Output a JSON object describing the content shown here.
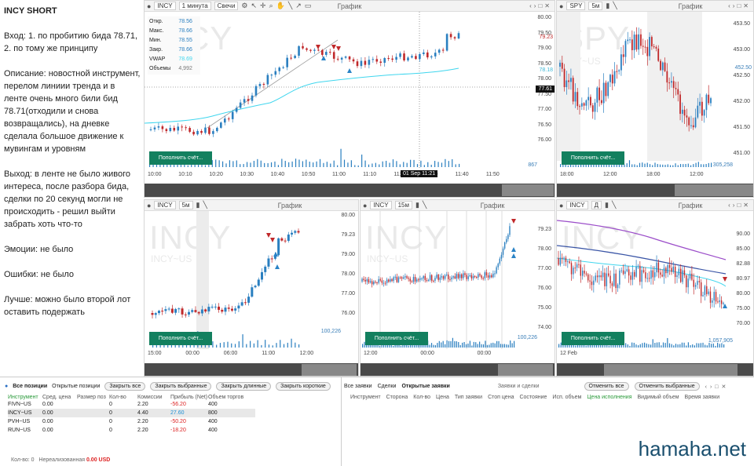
{
  "notes": {
    "title": "INCY SHORT",
    "entry": "Вход: 1. по пробитию бида 78.71, 2. по тому же принципу",
    "description": "Описание: новостной инструмент, перелом линиии тренда и в ленте очень много били бид 78.71(отходили и снова возвращались), на дневке сделала большое движение к мувингам и уровням",
    "exit": "Выход: в ленте не было живого интереса, после разбора бида, сделки по 20 секунд могли не происходить - решил выйти забрать хоть что-то",
    "emotions": "Эмоции: не было",
    "errors": "Ошибки: не было",
    "better": "Лучше: можно было второй лот оставить подержать"
  },
  "common": {
    "chart_label": "График",
    "fund_button": "Пополнить счёт..."
  },
  "main": {
    "symbol": "INCY",
    "interval": "1 минута",
    "type": "Свечи",
    "watermark": "INCY",
    "ohlc": [
      [
        "Откр.",
        "78.56"
      ],
      [
        "Макс.",
        "78.66"
      ],
      [
        "Мин.",
        "78.55"
      ],
      [
        "Закр.",
        "78.66"
      ],
      [
        "VWAP",
        "78.69"
      ],
      [
        "Объемы",
        "4,992"
      ]
    ],
    "prices": [
      "80.00",
      "79.50",
      "79.00",
      "78.50",
      "78.00",
      "77.50",
      "77.00",
      "76.50",
      "76.00"
    ],
    "tags": {
      "red": "79.23",
      "vwap": "78.18",
      "cross": "77.61"
    },
    "times": [
      "10:00",
      "10:10",
      "10:20",
      "10:30",
      "10:40",
      "10:50",
      "11:00",
      "11:10",
      "11:20",
      "11:30",
      "11:40",
      "11:50"
    ],
    "cursor_time": "01 Sep 11:21",
    "volume": "867"
  },
  "spy": {
    "symbol": "SPY",
    "interval": "5м",
    "watermark": "SPY",
    "watermark_sub": "SPY~US",
    "prices": [
      "453.50",
      "453.00",
      "452.50",
      "452.00",
      "451.50",
      "451.00"
    ],
    "tag": "452.50",
    "times": [
      "18:00",
      "12:00",
      "18:00",
      "12:00"
    ],
    "volume": "305,258"
  },
  "incy5": {
    "symbol": "INCY",
    "interval": "5м",
    "watermark": "INCY",
    "watermark_sub": "INCY~US",
    "prices": [
      "80.00",
      "79.23",
      "79.00",
      "78.00",
      "77.00",
      "76.00"
    ],
    "times": [
      "15:00",
      "00:00",
      "06:00",
      "11:00",
      "12:00"
    ],
    "volume": "100,226"
  },
  "incy15": {
    "symbol": "INCY",
    "interval": "15м",
    "watermark": "INCY",
    "watermark_sub": "INCY~US",
    "prices": [
      "79.23",
      "78.00",
      "77.00",
      "76.00",
      "75.00",
      "74.00"
    ],
    "times": [
      "12:00",
      "00:00",
      "00:00"
    ],
    "volume": "100,226"
  },
  "incyd": {
    "symbol": "INCY",
    "interval": "Д",
    "watermark": "INCY",
    "prices": [
      "90.00",
      "85.00",
      "82.88",
      "80.97",
      "80.00",
      "75.00",
      "70.00"
    ],
    "times": [
      "12 Feb"
    ],
    "volume": "1,057,905"
  },
  "positions": {
    "tabs": [
      "Все позиции",
      "Открытые позиции"
    ],
    "buttons": [
      "Закрыть все",
      "Закрыть выбранные",
      "Закрыть длинные",
      "Закрыть короткие"
    ],
    "headers": [
      "Инструмент",
      "Сред. цена",
      "Размер поз",
      "Кол-во",
      "Комиссии",
      "Прибыль (Net)",
      "Объем торгов"
    ],
    "rows": [
      [
        "FIVN~US",
        "0.00",
        "",
        "0",
        "2.20",
        "-56.20",
        "400"
      ],
      [
        "INCY~US",
        "0.00",
        "",
        "0",
        "4.40",
        "27.60",
        "800"
      ],
      [
        "PVH~US",
        "0.00",
        "",
        "0",
        "2.20",
        "-50.20",
        "400"
      ],
      [
        "RUN~US",
        "0.00",
        "",
        "0",
        "2.20",
        "-18.20",
        "400"
      ]
    ],
    "footer_qty": "Кол-во: 0",
    "footer_unreal": "Нереализованная",
    "footer_value": "0.00 USD"
  },
  "orders": {
    "tabs": [
      "Все заявки",
      "Сделки",
      "Открытые заявки"
    ],
    "title": "Заявки и сделки",
    "buttons": [
      "Отменить все",
      "Отменить выбранные"
    ],
    "headers": [
      "Инструмент",
      "Сторона",
      "Кол-во",
      "Цена",
      "Тип заявки",
      "Стоп цена",
      "Состояние",
      "Исп. объем",
      "Цена исполнения",
      "Видимый объем",
      "Время заявки"
    ]
  },
  "brand": "hamaha.net"
}
